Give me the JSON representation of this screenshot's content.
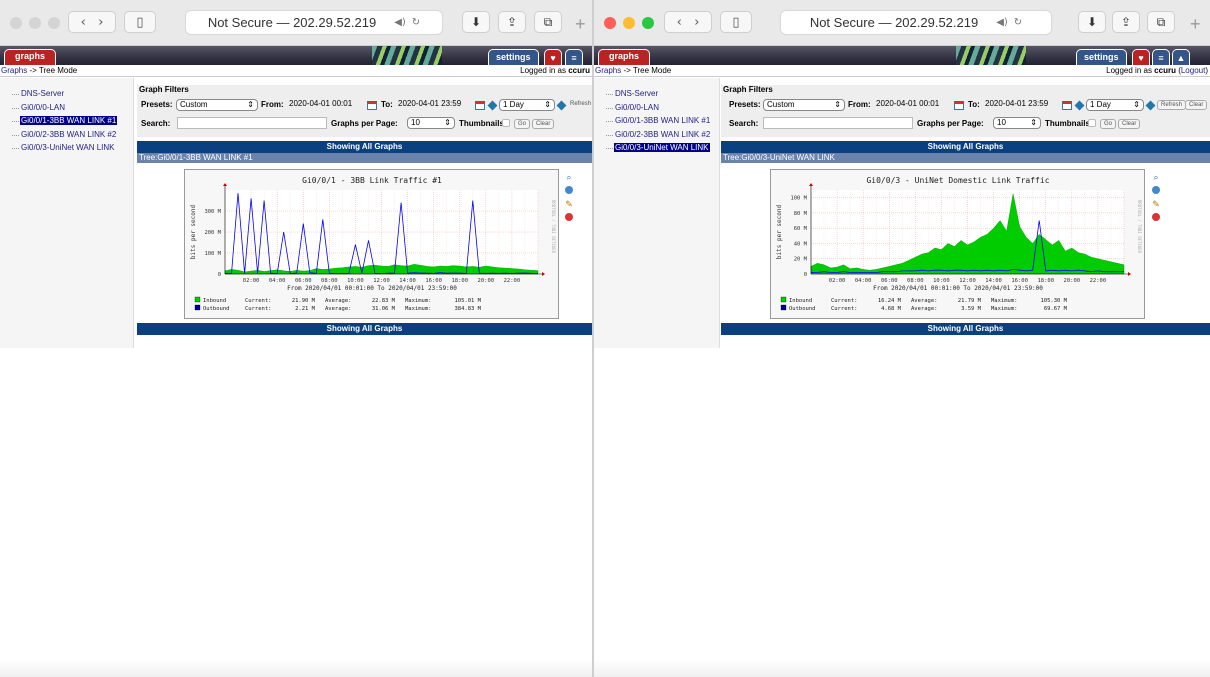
{
  "address": "Not Secure — 202.29.52.219",
  "tabs": {
    "graphs": "graphs",
    "settings": "settings"
  },
  "breadcrumb": {
    "link": "Graphs",
    "rest": " -> Tree Mode"
  },
  "logged": {
    "prefix": "Logged in as ",
    "user": "ccuru",
    "logout": "Logout"
  },
  "tree_items": [
    "DNS-Server",
    "Gi0/0/0-LAN",
    "Gi0/0/1-3BB WAN LINK #1",
    "Gi0/0/2-3BB WAN LINK #2",
    "Gi0/0/3-UniNet WAN LINK"
  ],
  "filters": {
    "title": "Graph Filters",
    "presets_label": "Presets:",
    "preset": "Custom",
    "from_label": "From:",
    "from": "2020-04-01 00:01",
    "to_label": "To:",
    "to": "2020-04-01 23:59",
    "timespan": "1 Day",
    "refresh": "Refresh",
    "clear": "Clear",
    "search_label": "Search:",
    "gpp_label": "Graphs per Page:",
    "gpp": "10",
    "thumbs_label": "Thumbnails:",
    "go": "Go"
  },
  "showing": "Showing All Graphs",
  "colors": {
    "inbound": "#00cc00",
    "outbound": "#0000ff",
    "bar": "#0a3f80"
  },
  "left": {
    "tree_label": "Tree:Gi0/0/1-3BB WAN LINK #1",
    "chart_data": {
      "type": "area",
      "title": "Gi0/0/1 - 3BB Link Traffic #1",
      "ylabel": "bits per second",
      "yticks": [
        "0",
        "100 M",
        "200 M",
        "300 M"
      ],
      "ylim": [
        0,
        400
      ],
      "xticks": [
        "02:00",
        "04:00",
        "06:00",
        "08:00",
        "10:00",
        "12:00",
        "14:00",
        "16:00",
        "18:00",
        "20:00",
        "22:00"
      ],
      "range_text": "From 2020/04/01 00:01:00 To 2020/04/01 23:59:00",
      "x_hours": [
        0,
        0.5,
        1,
        1.5,
        2,
        2.5,
        3,
        3.5,
        4,
        4.5,
        5,
        5.5,
        6,
        6.5,
        7,
        7.5,
        8,
        8.5,
        9,
        9.5,
        10,
        10.5,
        11,
        11.5,
        12,
        12.5,
        13,
        13.5,
        14,
        14.5,
        15,
        15.5,
        16,
        16.5,
        17,
        17.5,
        18,
        18.5,
        19,
        19.5,
        20,
        20.5,
        21,
        21.5,
        22,
        22.5,
        23,
        23.5,
        24
      ],
      "series": [
        {
          "name": "Inbound",
          "values": [
            15,
            22,
            18,
            10,
            14,
            18,
            12,
            16,
            20,
            15,
            12,
            18,
            14,
            16,
            26,
            22,
            24,
            28,
            30,
            34,
            36,
            32,
            40,
            42,
            38,
            36,
            44,
            40,
            38,
            46,
            42,
            36,
            34,
            38,
            36,
            40,
            38,
            34,
            36,
            32,
            38,
            34,
            30,
            28,
            26,
            24,
            20,
            18,
            16
          ]
        },
        {
          "name": "Outbound",
          "values": [
            3,
            2,
            385,
            2,
            360,
            3,
            350,
            4,
            2,
            200,
            2,
            5,
            240,
            6,
            3,
            260,
            4,
            2,
            3,
            3,
            140,
            4,
            160,
            3,
            2,
            4,
            5,
            340,
            4,
            6,
            5,
            4,
            3,
            6,
            4,
            5,
            4,
            3,
            350,
            4,
            3,
            4,
            3,
            4,
            3,
            4,
            5,
            3,
            2
          ]
        }
      ],
      "legend": [
        {
          "name": "Inbound",
          "current": "21.90 M",
          "average": "22.83 M",
          "maximum": "105.01 M"
        },
        {
          "name": "Outbound",
          "current": "2.21 M",
          "average": "31.06 M",
          "maximum": "384.83 M"
        }
      ]
    }
  },
  "right": {
    "tree_label": "Tree:Gi0/0/3-UniNet WAN LINK",
    "chart_data": {
      "type": "area",
      "title": "Gi0/0/3 - UniNet Domestic Link Traffic",
      "ylabel": "bits per second",
      "yticks": [
        "0",
        "20 M",
        "40 M",
        "60 M",
        "80 M",
        "100 M"
      ],
      "ylim": [
        0,
        110
      ],
      "xticks": [
        "02:00",
        "04:00",
        "06:00",
        "08:00",
        "10:00",
        "12:00",
        "14:00",
        "16:00",
        "18:00",
        "20:00",
        "22:00"
      ],
      "range_text": "From 2020/04/01 00:01:00 To 2020/04/01 23:59:00",
      "x_hours": [
        0,
        0.5,
        1,
        1.5,
        2,
        2.5,
        3,
        3.5,
        4,
        4.5,
        5,
        5.5,
        6,
        6.5,
        7,
        7.5,
        8,
        8.5,
        9,
        9.5,
        10,
        10.5,
        11,
        11.5,
        12,
        12.5,
        13,
        13.5,
        14,
        14.5,
        15,
        15.5,
        16,
        16.5,
        17,
        17.5,
        18,
        18.5,
        19,
        19.5,
        20,
        20.5,
        21,
        21.5,
        22,
        22.5,
        23,
        23.5,
        24
      ],
      "series": [
        {
          "name": "Inbound",
          "values": [
            10,
            14,
            12,
            8,
            9,
            12,
            7,
            8,
            6,
            5,
            6,
            8,
            10,
            12,
            14,
            18,
            22,
            26,
            28,
            34,
            32,
            40,
            36,
            44,
            38,
            42,
            48,
            52,
            60,
            70,
            56,
            105,
            62,
            48,
            40,
            52,
            45,
            38,
            44,
            30,
            34,
            28,
            26,
            22,
            20,
            18,
            16,
            14,
            12
          ]
        },
        {
          "name": "Outbound",
          "values": [
            2,
            2,
            3,
            2,
            2,
            3,
            2,
            2,
            2,
            2,
            2,
            3,
            3,
            3,
            4,
            4,
            4,
            5,
            4,
            5,
            5,
            4,
            5,
            5,
            4,
            5,
            4,
            5,
            4,
            5,
            4,
            6,
            5,
            4,
            5,
            70,
            4,
            5,
            4,
            5,
            4,
            5,
            4,
            3,
            4,
            3,
            3,
            3,
            3
          ]
        }
      ],
      "legend": [
        {
          "name": "Inbound",
          "current": "16.24 M",
          "average": "21.79 M",
          "maximum": "105.30 M"
        },
        {
          "name": "Outbound",
          "current": "4.68 M",
          "average": "3.59 M",
          "maximum": "69.67 M"
        }
      ]
    }
  }
}
